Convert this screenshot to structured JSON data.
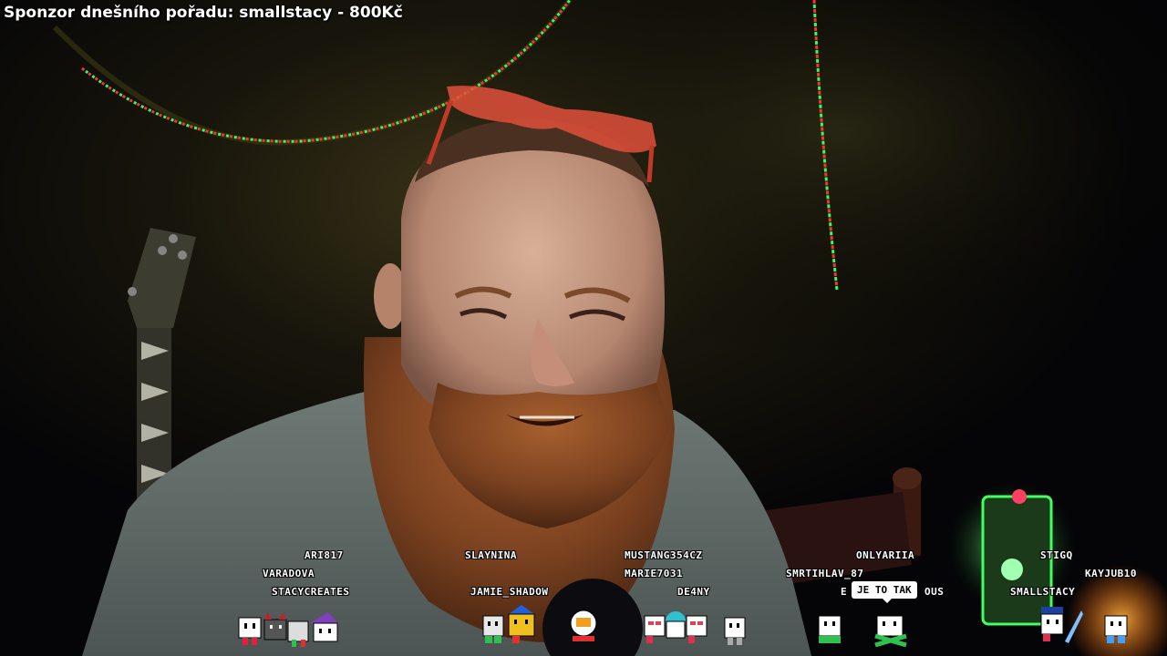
{
  "overlay": {
    "sponsor_text": "Sponzor dnešního pořadu: smallstacy - 800Kč",
    "chat_bubble": "JE TO TAK"
  },
  "viewers": {
    "ari17": "ARI817",
    "varadova": "VARADOVA",
    "stacycreates": "STACYCREATES",
    "slaynina": "SLAYNINA",
    "jamie_shadow": "JAMIE_SHADOW",
    "mustang": "MUSTANG354CZ",
    "marie": "MARIE7031",
    "de4ny": "DE4NY",
    "onlyariia": "ONLYARIIA",
    "smrtihlav": "SMRTIHLAV_87",
    "bubble_user_left": "E",
    "bubble_user_right": "OUS",
    "stigq": "STIGQ",
    "kayjub": "KAYJUB10",
    "smallstacy": "SMALLSTACY"
  },
  "colors": {
    "led_red": "#ff3030",
    "led_green": "#30ff60",
    "shirt": "#5f6b67",
    "beard": "#8a4a22",
    "skin": "#c99a80"
  }
}
